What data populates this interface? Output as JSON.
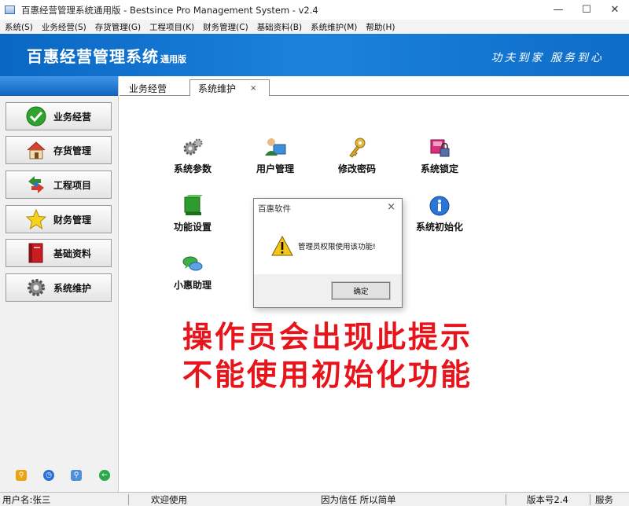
{
  "window": {
    "title": "百惠经营管理系统通用版 - Bestsince Pro Management System - v2.4",
    "buttons": [
      "minimize",
      "maximize",
      "close"
    ]
  },
  "menu": [
    "系统(S)",
    "业务经营(S)",
    "存货管理(G)",
    "工程项目(K)",
    "财务管理(C)",
    "基础资料(B)",
    "系统维护(M)",
    "帮助(H)"
  ],
  "banner": {
    "brand": "百惠经营管理系统",
    "edition": "通用版",
    "slogan": "功夫到家 服务到心"
  },
  "sidebar": {
    "items": [
      {
        "label": "业务经营",
        "icon": "check-circle-icon"
      },
      {
        "label": "存货管理",
        "icon": "house-icon"
      },
      {
        "label": "工程项目",
        "icon": "recycle-arrows-icon"
      },
      {
        "label": "财务管理",
        "icon": "star-icon"
      },
      {
        "label": "基础资料",
        "icon": "red-book-icon"
      },
      {
        "label": "系统维护",
        "icon": "gear-icon"
      }
    ],
    "bottom_icons": [
      "key-icon",
      "clock-icon",
      "search-icon",
      "back-arrow-icon"
    ]
  },
  "tabs": [
    {
      "label": "业务经营",
      "active": false
    },
    {
      "label": "系统维护",
      "active": true,
      "close": "×"
    }
  ],
  "tools": [
    {
      "label": "系统参数",
      "icon": "gears-icon"
    },
    {
      "label": "用户管理",
      "icon": "user-monitor-icon"
    },
    {
      "label": "修改密码",
      "icon": "key-icon"
    },
    {
      "label": "系统锁定",
      "icon": "lock-box-icon"
    },
    {
      "label": "功能设置",
      "icon": "green-box-icon"
    },
    {
      "label": "系统初始化",
      "icon": "info-icon"
    },
    {
      "label": "小惠助理",
      "icon": "chat-bubbles-icon"
    }
  ],
  "dialog": {
    "title": "百惠软件",
    "close": "×",
    "message": "管理员权限使用该功能!",
    "ok_label": "确定",
    "icon": "warning-icon"
  },
  "annotation": {
    "line1": "操作员会出现此提示",
    "line2": "不能使用初始化功能",
    "color": "#e8141b"
  },
  "status": {
    "user": "用户名:张三",
    "welcome": "欢迎使用",
    "motto": "因为信任 所以简单",
    "version": "版本号2.4",
    "service": "服务"
  }
}
